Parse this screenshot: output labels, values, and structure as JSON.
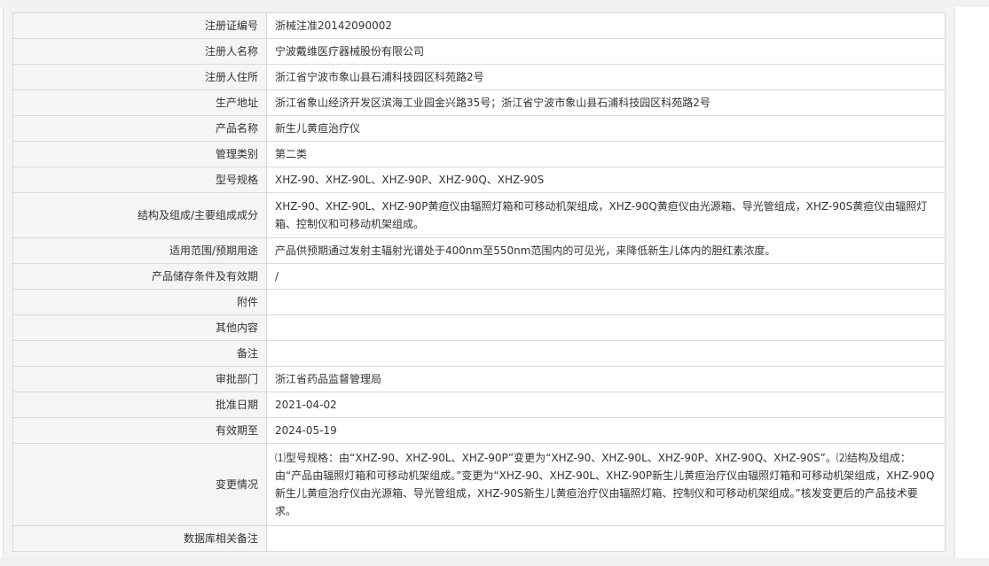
{
  "rows": [
    {
      "label": "注册证编号",
      "value": "浙械注准20142090002"
    },
    {
      "label": "注册人名称",
      "value": "宁波戴维医疗器械股份有限公司"
    },
    {
      "label": "注册人住所",
      "value": "浙江省宁波市象山县石浦科技园区科苑路2号"
    },
    {
      "label": "生产地址",
      "value": "浙江省象山经济开发区滨海工业园金兴路35号；浙江省宁波市象山县石浦科技园区科苑路2号"
    },
    {
      "label": "产品名称",
      "value": "新生儿黄疸治疗仪"
    },
    {
      "label": "管理类别",
      "value": "第二类"
    },
    {
      "label": "型号规格",
      "value": "XHZ-90、XHZ-90L、XHZ-90P、XHZ-90Q、XHZ-90S"
    },
    {
      "label": "结构及组成/主要组成成分",
      "value": "XHZ-90、XHZ-90L、XHZ-90P黄疸仪由辐照灯箱和可移动机架组成，XHZ-90Q黄疸仪由光源箱、导光管组成，XHZ-90S黄疸仪由辐照灯箱、控制仪和可移动机架组成。"
    },
    {
      "label": "适用范围/预期用途",
      "value": "产品供预期通过发射主辐射光谱处于400nm至550nm范围内的可见光，来降低新生儿体内的胆红素浓度。"
    },
    {
      "label": "产品储存条件及有效期",
      "value": "/"
    },
    {
      "label": "附件",
      "value": ""
    },
    {
      "label": "其他内容",
      "value": ""
    },
    {
      "label": "备注",
      "value": ""
    },
    {
      "label": "审批部门",
      "value": "浙江省药品监督管理局"
    },
    {
      "label": "批准日期",
      "value": "2021-04-02"
    },
    {
      "label": "有效期至",
      "value": "2024-05-19"
    },
    {
      "label": "变更情况",
      "value": "⑴型号规格：由“XHZ-90、XHZ-90L、XHZ-90P”变更为“XHZ-90、XHZ-90L、XHZ-90P、XHZ-90Q、XHZ-90S”。⑵结构及组成：由“产品由辐照灯箱和可移动机架组成。”变更为“XHZ-90、XHZ-90L、XHZ-90P新生儿黄疸治疗仪由辐照灯箱和可移动机架组成，XHZ-90Q新生儿黄疸治疗仪由光源箱、导光管组成，XHZ-90S新生儿黄疸治疗仪由辐照灯箱、控制仪和可移动机架组成。”核发变更后的产品技术要求。"
    },
    {
      "label": "数据库相关备注",
      "value": ""
    }
  ]
}
